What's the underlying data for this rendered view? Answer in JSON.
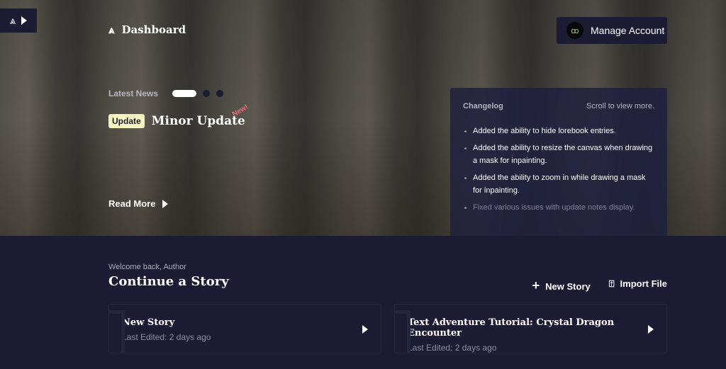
{
  "header": {
    "title": "Dashboard",
    "manage_account": "Manage Account"
  },
  "news": {
    "label": "Latest News",
    "badge": "Update",
    "title": "Minor Update",
    "new_tag": "New!",
    "read_more": "Read More",
    "slides": 3,
    "active_slide": 1
  },
  "changelog": {
    "title": "Changelog",
    "hint": "Scroll to view more.",
    "items": [
      "Added the ability to hide lorebook entries.",
      "Added the ability to resize the canvas when drawing a mask for inpainting.",
      "Added the ability to zoom in while drawing a mask for inpainting.",
      "Fixed various issues with update notes display."
    ]
  },
  "main": {
    "welcome": "Welcome back, Author",
    "heading": "Continue a Story",
    "new_story": "New Story",
    "import_file": "Import File",
    "stories": [
      {
        "title": "New Story",
        "edited": "Last Edited: 2 days ago"
      },
      {
        "title": "Text Adventure Tutorial: Crystal Dragon Encounter",
        "edited": "Last Edited: 2 days ago"
      }
    ]
  }
}
